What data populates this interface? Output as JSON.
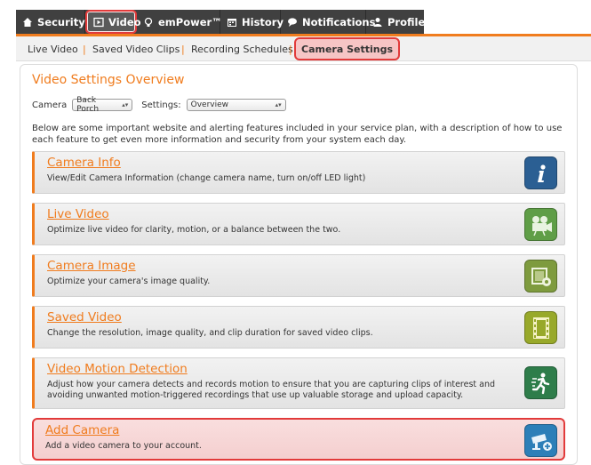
{
  "topnav": {
    "tabs": [
      {
        "label": "Security",
        "icon": "home-icon"
      },
      {
        "label": "Video",
        "icon": "video-icon"
      },
      {
        "label": "emPower™",
        "icon": "lightbulb-icon"
      },
      {
        "label": "History",
        "icon": "calendar-icon"
      },
      {
        "label": "Notifications",
        "icon": "speech-bubble-icon"
      },
      {
        "label": "Profile",
        "icon": "person-icon"
      }
    ]
  },
  "subnav": {
    "items": [
      "Live Video",
      "Saved Video Clips",
      "Recording Schedules",
      "Camera Settings"
    ],
    "separator": "|"
  },
  "main": {
    "title": "Video Settings Overview",
    "camera_label": "Camera",
    "camera_value": "Back Porch",
    "settings_label": "Settings:",
    "settings_value": "Overview",
    "intro": "Below are some important website and alerting features included in your service plan, with a description of how to use each feature to get even more information and security from your system each day.",
    "cards": [
      {
        "title": "Camera Info",
        "desc": "View/Edit Camera Information (change camera name, turn on/off LED light)",
        "icon": "info-icon",
        "color": "#2b5f93"
      },
      {
        "title": "Live Video",
        "desc": "Optimize live video for clarity, motion, or a balance between the two.",
        "icon": "movie-camera-icon",
        "color": "#5f9e47"
      },
      {
        "title": "Camera Image",
        "desc": "Optimize your camera's image quality.",
        "icon": "image-settings-icon",
        "color": "#7e9b3e"
      },
      {
        "title": "Saved Video",
        "desc": "Change the resolution, image quality, and clip duration for saved video clips.",
        "icon": "film-strip-icon",
        "color": "#98a92a"
      },
      {
        "title": "Video Motion Detection",
        "desc": "Adjust how your camera detects and records motion to ensure that you are capturing clips of interest and avoiding unwanted motion-triggered recordings that use up valuable storage and upload capacity.",
        "icon": "running-person-icon",
        "color": "#2e7d4a"
      },
      {
        "title": "Add Camera",
        "desc": "Add a video camera to your account.",
        "icon": "add-camera-icon",
        "color": "#2d7fb8"
      }
    ]
  }
}
